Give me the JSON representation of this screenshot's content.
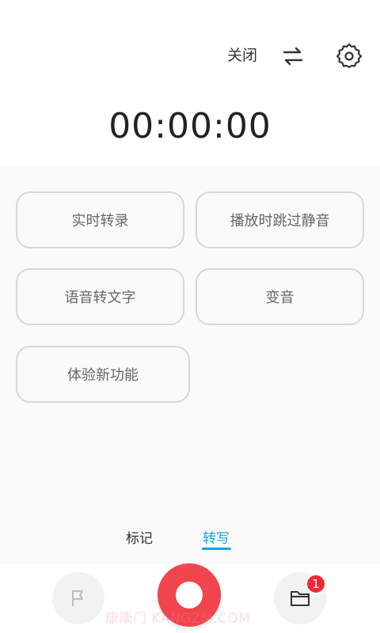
{
  "header": {
    "close_label": "关闭",
    "timer": "00:00:00"
  },
  "features": {
    "realtime_transcribe": "实时转录",
    "skip_silence": "播放时跳过静音",
    "speech_to_text": "语音转文字",
    "voice_change": "变音",
    "try_new": "体验新功能"
  },
  "mode_tabs": {
    "mark": "标记",
    "transcribe": "转写",
    "active": "transcribe"
  },
  "bottom": {
    "folder_badge": "1",
    "watermark": "康康门 KANGZM.COM"
  },
  "colors": {
    "accent": "#1aa0e0",
    "record": "#f0454d",
    "badge": "#f02a35"
  },
  "icons": [
    "swap-icon",
    "gear-icon",
    "flag-icon",
    "record-icon",
    "folder-icon"
  ]
}
